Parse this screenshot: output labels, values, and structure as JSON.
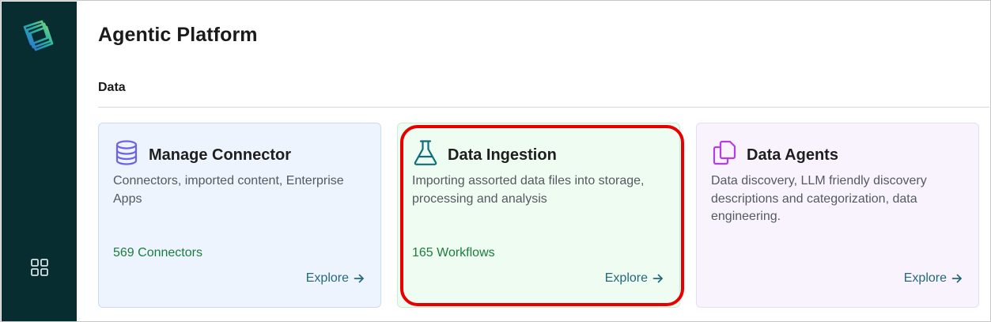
{
  "app": {
    "title": "Agentic Platform",
    "logo_icon": "layered-squares-logo-icon",
    "nav_icon": "apps-grid-icon"
  },
  "section": {
    "title": "Data"
  },
  "cards": [
    {
      "icon": "database-icon",
      "icon_color": "#6b63e8",
      "title": "Manage Connector",
      "description": "Connectors, imported content, Enterprise Apps",
      "stat": "569 Connectors",
      "explore_label": "Explore"
    },
    {
      "icon": "flask-icon",
      "icon_color": "#0f6f78",
      "title": "Data Ingestion",
      "description": "Importing assorted data files into storage, processing and analysis",
      "stat": "165 Workflows",
      "explore_label": "Explore",
      "highlighted": true
    },
    {
      "icon": "copy-documents-icon",
      "icon_color": "#b13ee6",
      "title": "Data Agents",
      "description": "Data discovery, LLM friendly discovery descriptions and categorization, data engineering.",
      "stat": "",
      "explore_label": "Explore"
    }
  ],
  "colors": {
    "sidebar": "#072d31",
    "stat_green": "#1b7d3c",
    "explore_teal": "#23697a",
    "highlight_red": "#e60000"
  }
}
